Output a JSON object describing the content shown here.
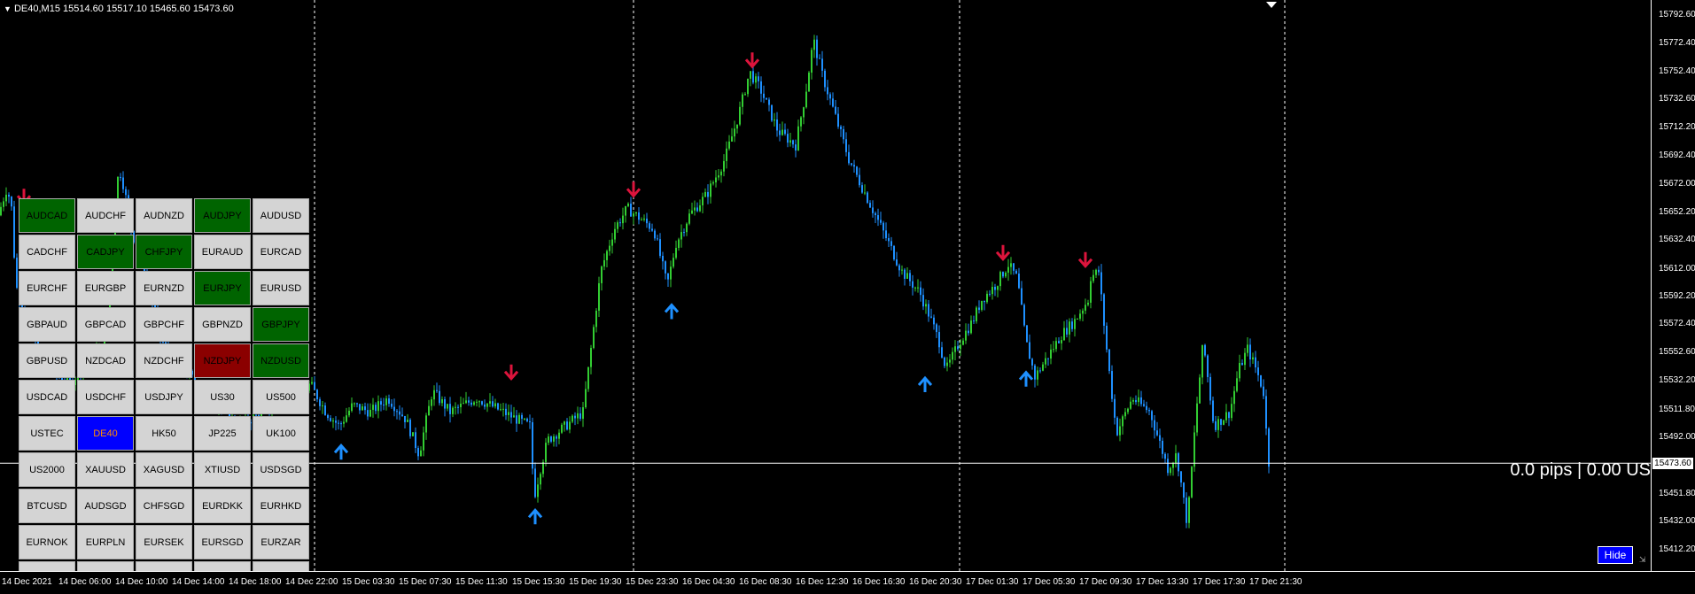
{
  "header": {
    "symbol": "DE40,M15",
    "ohlc": "15514.60 15517.10 15465.60 15473.60"
  },
  "price_scale": {
    "labels": [
      "15792.60",
      "15772.40",
      "15752.40",
      "15732.60",
      "15712.20",
      "15692.40",
      "15672.00",
      "15652.20",
      "15632.40",
      "15612.00",
      "15592.20",
      "15572.40",
      "15552.60",
      "15532.20",
      "15511.80",
      "15492.00",
      "15451.80",
      "15432.00",
      "15412.20"
    ],
    "current": "15473.60"
  },
  "time_scale": {
    "labels": [
      "14 Dec 2021",
      "14 Dec 06:00",
      "14 Dec 10:00",
      "14 Dec 14:00",
      "14 Dec 18:00",
      "14 Dec 22:00",
      "15 Dec 03:30",
      "15 Dec 07:30",
      "15 Dec 11:30",
      "15 Dec 15:30",
      "15 Dec 19:30",
      "15 Dec 23:30",
      "16 Dec 04:30",
      "16 Dec 08:30",
      "16 Dec 12:30",
      "16 Dec 16:30",
      "16 Dec 20:30",
      "17 Dec 01:30",
      "17 Dec 05:30",
      "17 Dec 09:30",
      "17 Dec 13:30",
      "17 Dec 17:30",
      "17 Dec 21:30"
    ]
  },
  "pips_readout": "0.0 pips | 0.00 US",
  "hide_button": "Hide",
  "colors": {
    "bull": "#32cd32",
    "bear": "#1e90ff",
    "arrow_down": "#dc143c",
    "arrow_up": "#1e90ff",
    "grid_green": "#006400",
    "grid_red": "#8b0000",
    "grid_selected": "#0000ff",
    "grid_default": "#d4d4d4"
  },
  "symbols": [
    {
      "label": "AUDCAD",
      "state": "green"
    },
    {
      "label": "AUDCHF",
      "state": "default"
    },
    {
      "label": "AUDNZD",
      "state": "default"
    },
    {
      "label": "AUDJPY",
      "state": "green"
    },
    {
      "label": "AUDUSD",
      "state": "default"
    },
    {
      "label": "CADCHF",
      "state": "default"
    },
    {
      "label": "CADJPY",
      "state": "green"
    },
    {
      "label": "CHFJPY",
      "state": "green"
    },
    {
      "label": "EURAUD",
      "state": "default"
    },
    {
      "label": "EURCAD",
      "state": "default"
    },
    {
      "label": "EURCHF",
      "state": "default"
    },
    {
      "label": "EURGBP",
      "state": "default"
    },
    {
      "label": "EURNZD",
      "state": "default"
    },
    {
      "label": "EURJPY",
      "state": "green"
    },
    {
      "label": "EURUSD",
      "state": "default"
    },
    {
      "label": "GBPAUD",
      "state": "default"
    },
    {
      "label": "GBPCAD",
      "state": "default"
    },
    {
      "label": "GBPCHF",
      "state": "default"
    },
    {
      "label": "GBPNZD",
      "state": "default"
    },
    {
      "label": "GBPJPY",
      "state": "green"
    },
    {
      "label": "GBPUSD",
      "state": "default"
    },
    {
      "label": "NZDCAD",
      "state": "default"
    },
    {
      "label": "NZDCHF",
      "state": "default"
    },
    {
      "label": "NZDJPY",
      "state": "red"
    },
    {
      "label": "NZDUSD",
      "state": "green"
    },
    {
      "label": "USDCAD",
      "state": "default"
    },
    {
      "label": "USDCHF",
      "state": "default"
    },
    {
      "label": "USDJPY",
      "state": "default"
    },
    {
      "label": "US30",
      "state": "default"
    },
    {
      "label": "US500",
      "state": "default"
    },
    {
      "label": "USTEC",
      "state": "default"
    },
    {
      "label": "DE40",
      "state": "selected"
    },
    {
      "label": "HK50",
      "state": "default"
    },
    {
      "label": "JP225",
      "state": "default"
    },
    {
      "label": "UK100",
      "state": "default"
    },
    {
      "label": "US2000",
      "state": "default"
    },
    {
      "label": "XAUUSD",
      "state": "default"
    },
    {
      "label": "XAGUSD",
      "state": "default"
    },
    {
      "label": "XTIUSD",
      "state": "default"
    },
    {
      "label": "USDSGD",
      "state": "default"
    },
    {
      "label": "BTCUSD",
      "state": "default"
    },
    {
      "label": "AUDSGD",
      "state": "default"
    },
    {
      "label": "CHFSGD",
      "state": "default"
    },
    {
      "label": "EURDKK",
      "state": "default"
    },
    {
      "label": "EURHKD",
      "state": "default"
    },
    {
      "label": "EURNOK",
      "state": "default"
    },
    {
      "label": "EURPLN",
      "state": "default"
    },
    {
      "label": "EURSEK",
      "state": "default"
    },
    {
      "label": "EURSGD",
      "state": "default"
    },
    {
      "label": "EURZAR",
      "state": "default"
    },
    {
      "label": "",
      "state": "default"
    },
    {
      "label": "",
      "state": "default"
    },
    {
      "label": "",
      "state": "default"
    },
    {
      "label": "",
      "state": "default"
    },
    {
      "label": "",
      "state": "default"
    }
  ],
  "chart_data": {
    "type": "candlestick",
    "y_range": [
      15402,
      15800
    ],
    "current_price": 15473.6,
    "price_path": [
      [
        0,
        15650
      ],
      [
        10,
        15670
      ],
      [
        15,
        15655
      ],
      [
        20,
        15600
      ],
      [
        40,
        15560
      ],
      [
        60,
        15540
      ],
      [
        80,
        15530
      ],
      [
        100,
        15545
      ],
      [
        120,
        15560
      ],
      [
        132,
        15650
      ],
      [
        136,
        15685
      ],
      [
        142,
        15670
      ],
      [
        150,
        15640
      ],
      [
        165,
        15610
      ],
      [
        185,
        15560
      ],
      [
        210,
        15540
      ],
      [
        240,
        15520
      ],
      [
        270,
        15500
      ],
      [
        300,
        15510
      ],
      [
        340,
        15520
      ],
      [
        352,
        15530
      ],
      [
        370,
        15510
      ],
      [
        385,
        15500
      ],
      [
        400,
        15515
      ],
      [
        420,
        15510
      ],
      [
        440,
        15520
      ],
      [
        460,
        15505
      ],
      [
        475,
        15480
      ],
      [
        490,
        15525
      ],
      [
        510,
        15510
      ],
      [
        540,
        15520
      ],
      [
        570,
        15510
      ],
      [
        600,
        15500
      ],
      [
        605,
        15450
      ],
      [
        612,
        15470
      ],
      [
        620,
        15490
      ],
      [
        640,
        15500
      ],
      [
        660,
        15510
      ],
      [
        670,
        15560
      ],
      [
        680,
        15610
      ],
      [
        695,
        15640
      ],
      [
        710,
        15655
      ],
      [
        720,
        15650
      ],
      [
        740,
        15640
      ],
      [
        755,
        15600
      ],
      [
        765,
        15630
      ],
      [
        780,
        15650
      ],
      [
        800,
        15665
      ],
      [
        820,
        15690
      ],
      [
        835,
        15720
      ],
      [
        848,
        15752
      ],
      [
        860,
        15740
      ],
      [
        880,
        15710
      ],
      [
        900,
        15700
      ],
      [
        912,
        15740
      ],
      [
        920,
        15775
      ],
      [
        930,
        15750
      ],
      [
        945,
        15720
      ],
      [
        960,
        15690
      ],
      [
        975,
        15670
      ],
      [
        990,
        15650
      ],
      [
        1005,
        15630
      ],
      [
        1020,
        15610
      ],
      [
        1040,
        15595
      ],
      [
        1050,
        15580
      ],
      [
        1062,
        15560
      ],
      [
        1070,
        15540
      ],
      [
        1085,
        15560
      ],
      [
        1100,
        15575
      ],
      [
        1110,
        15590
      ],
      [
        1125,
        15600
      ],
      [
        1140,
        15615
      ],
      [
        1150,
        15605
      ],
      [
        1160,
        15560
      ],
      [
        1170,
        15535
      ],
      [
        1185,
        15550
      ],
      [
        1200,
        15565
      ],
      [
        1215,
        15575
      ],
      [
        1230,
        15590
      ],
      [
        1230,
        15605
      ],
      [
        1242,
        15610
      ],
      [
        1250,
        15560
      ],
      [
        1262,
        15495
      ],
      [
        1280,
        15520
      ],
      [
        1300,
        15510
      ],
      [
        1310,
        15490
      ],
      [
        1320,
        15470
      ],
      [
        1330,
        15480
      ],
      [
        1342,
        15430
      ],
      [
        1352,
        15510
      ],
      [
        1360,
        15560
      ],
      [
        1372,
        15500
      ],
      [
        1390,
        15510
      ],
      [
        1400,
        15540
      ],
      [
        1410,
        15555
      ],
      [
        1420,
        15540
      ],
      [
        1430,
        15520
      ],
      [
        1432,
        15474
      ]
    ],
    "signals_down": [
      [
        577,
        15530
      ],
      [
        715,
        15660
      ],
      [
        849,
        15752
      ],
      [
        1132,
        15615
      ],
      [
        1225,
        15610
      ],
      [
        27,
        15655
      ]
    ],
    "signals_up": [
      [
        385,
        15490
      ],
      [
        604,
        15444
      ],
      [
        758,
        15590
      ],
      [
        1044,
        15538
      ],
      [
        1158,
        15542
      ]
    ],
    "session_separators": [
      355,
      715,
      1083,
      1450
    ]
  }
}
